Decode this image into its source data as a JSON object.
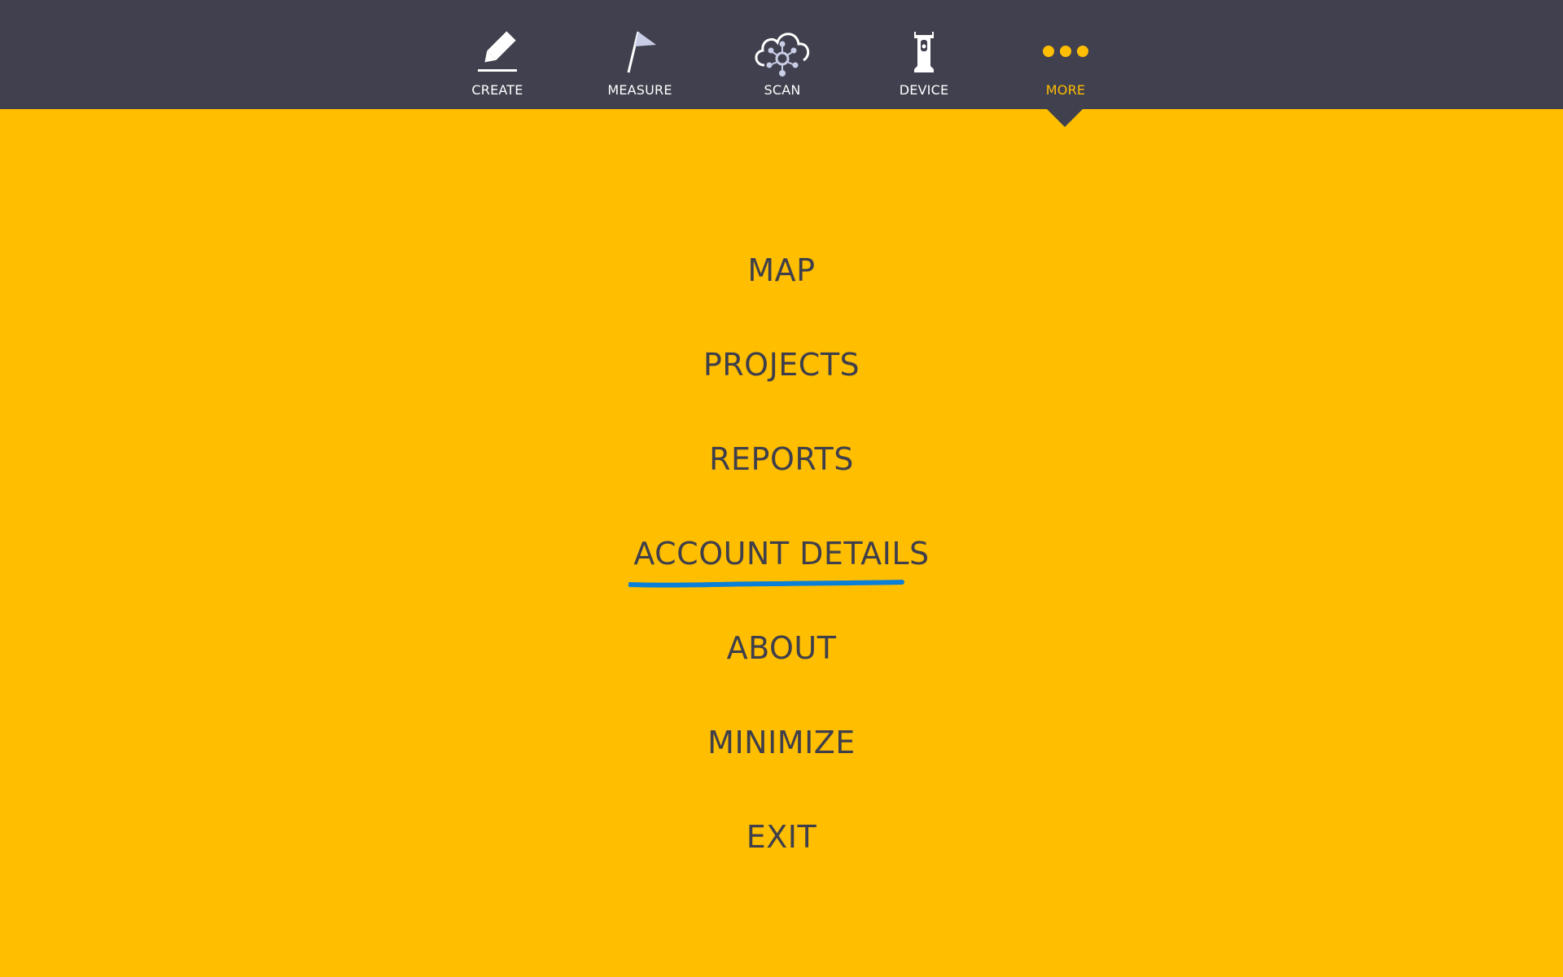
{
  "nav": {
    "items": [
      {
        "label": "CREATE",
        "icon": "eraser-pencil-icon"
      },
      {
        "label": "MEASURE",
        "icon": "flag-icon"
      },
      {
        "label": "SCAN",
        "icon": "cloud-scan-icon"
      },
      {
        "label": "DEVICE",
        "icon": "total-station-icon"
      },
      {
        "label": "MORE",
        "icon": "more-dots-icon",
        "active": true
      }
    ]
  },
  "menu": {
    "items": [
      {
        "label": "MAP"
      },
      {
        "label": "PROJECTS"
      },
      {
        "label": "REPORTS"
      },
      {
        "label": "ACCOUNT DETAILS",
        "annotated": true
      },
      {
        "label": "ABOUT"
      },
      {
        "label": "MINIMIZE"
      },
      {
        "label": "EXIT"
      }
    ]
  },
  "colors": {
    "background": "#FFBE00",
    "topbar": "#40404E",
    "accent": "#FFBE00",
    "menu_text": "#3F3F4B",
    "annotation": "#0A7FD8"
  }
}
